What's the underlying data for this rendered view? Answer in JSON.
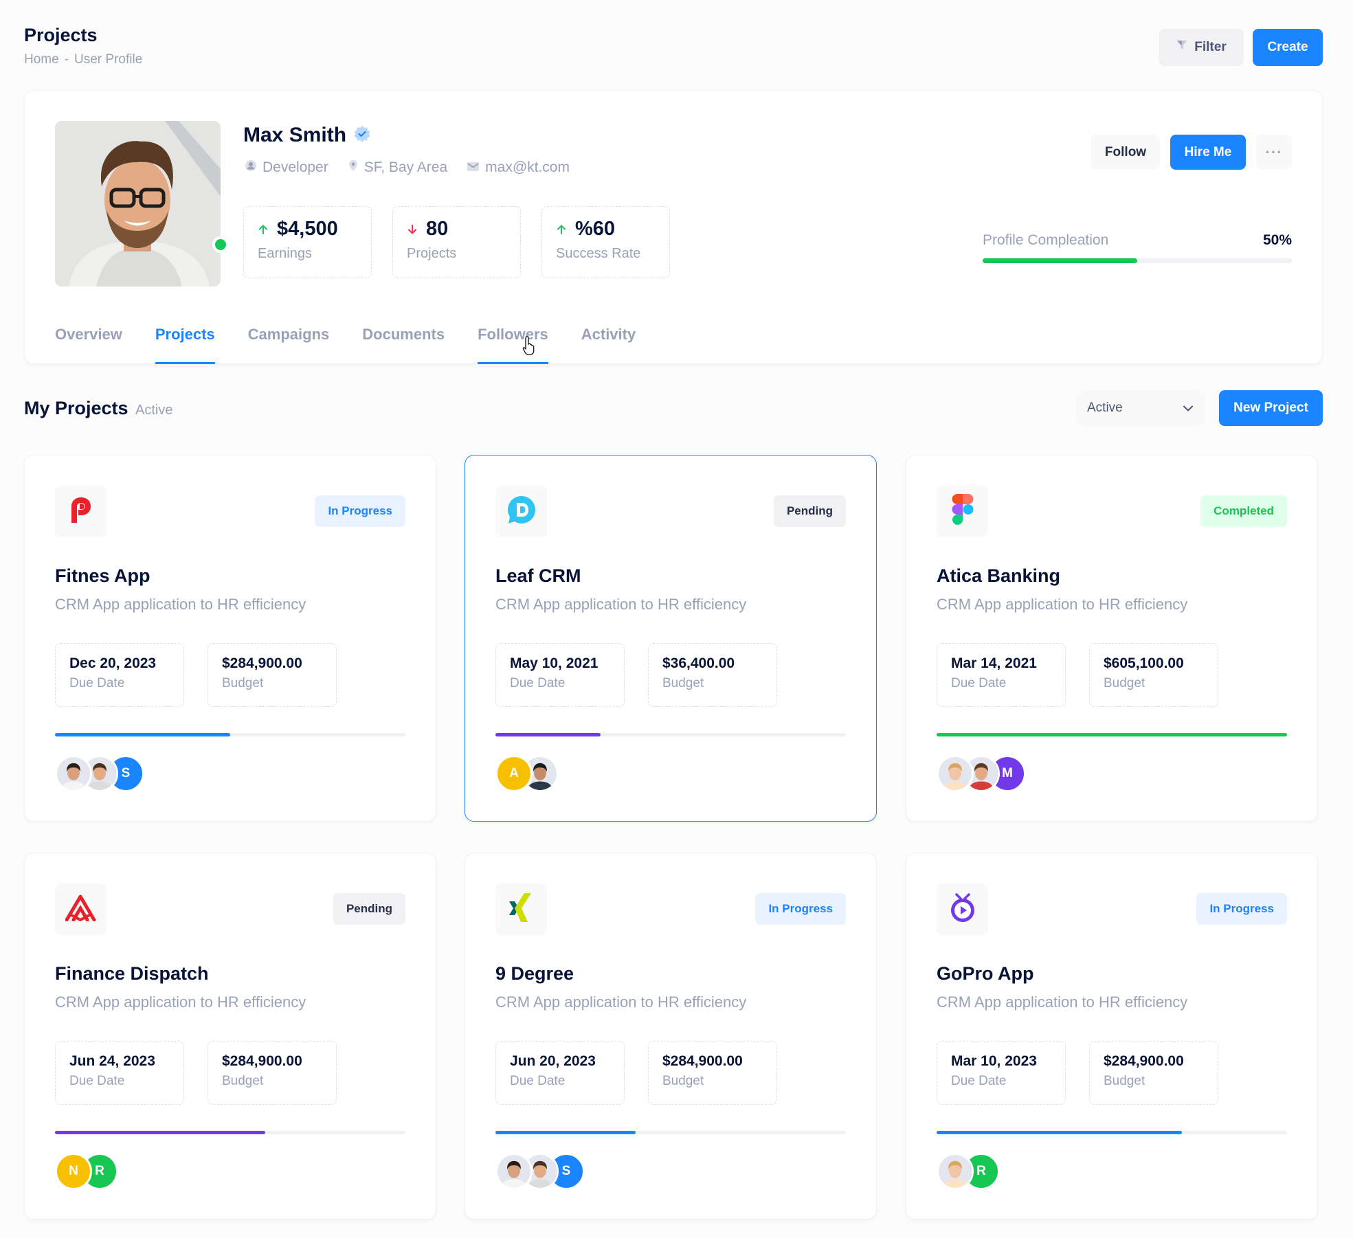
{
  "toolbar": {
    "title": "Projects",
    "breadcrumb": [
      "Home",
      "User Profile"
    ],
    "breadcrumb_sep": "-",
    "filter_label": "Filter",
    "create_label": "Create"
  },
  "profile": {
    "name": "Max Smith",
    "role": "Developer",
    "location": "SF, Bay Area",
    "email": "max@kt.com",
    "status": "online",
    "follow_label": "Follow",
    "hire_label": "Hire Me",
    "more_label": "···",
    "stats": [
      {
        "value": "$4,500",
        "label": "Earnings",
        "trend": "up"
      },
      {
        "value": "80",
        "label": "Projects",
        "trend": "down"
      },
      {
        "value": "%60",
        "label": "Success Rate",
        "trend": "up"
      }
    ],
    "completion": {
      "label": "Profile Compleation",
      "value": "50%",
      "fraction": 0.5
    },
    "tabs": [
      "Overview",
      "Projects",
      "Campaigns",
      "Documents",
      "Followers",
      "Activity"
    ],
    "active_tab": "Projects",
    "hover_tab": "Followers"
  },
  "projects_section": {
    "title": "My Projects",
    "subtitle": "Active",
    "select_value": "Active",
    "new_project_label": "New Project"
  },
  "projects": [
    {
      "name": "Fitnes App",
      "desc": "CRM App application to HR efficiency",
      "status": "In Progress",
      "due": "Dec 20, 2023",
      "due_label": "Due Date",
      "budget": "$284,900.00",
      "budget_label": "Budget",
      "progress": 0.5,
      "bar_color": "#1b84ff",
      "logo": "p-logo-icon",
      "team": [
        "photo-woman",
        "photo-man",
        "S"
      ]
    },
    {
      "name": "Leaf CRM",
      "desc": "CRM App application to HR efficiency",
      "status": "Pending",
      "due": "May 10, 2021",
      "due_label": "Due Date",
      "budget": "$36,400.00",
      "budget_label": "Budget",
      "progress": 0.3,
      "bar_color": "#7239ea",
      "logo": "chat-d-logo-icon",
      "team": [
        "A",
        "photo-man-dark"
      ]
    },
    {
      "name": "Atica Banking",
      "desc": "CRM App application to HR efficiency",
      "status": "Completed",
      "due": "Mar 14, 2021",
      "due_label": "Due Date",
      "budget": "$605,100.00",
      "budget_label": "Budget",
      "progress": 1.0,
      "bar_color": "#17c653",
      "logo": "figma-logo-icon",
      "team": [
        "photo-woman-blonde",
        "photo-man-red",
        "M"
      ]
    },
    {
      "name": "Finance Dispatch",
      "desc": "CRM App application to HR efficiency",
      "status": "Pending",
      "due": "Jun 24, 2023",
      "due_label": "Due Date",
      "budget": "$284,900.00",
      "budget_label": "Budget",
      "progress": 0.6,
      "bar_color": "#7239ea",
      "logo": "sketch-lines-logo-icon",
      "team": [
        "N",
        "R"
      ]
    },
    {
      "name": "9 Degree",
      "desc": "CRM App application to HR efficiency",
      "status": "In Progress",
      "due": "Jun 20, 2023",
      "due_label": "Due Date",
      "budget": "$284,900.00",
      "budget_label": "Budget",
      "progress": 0.4,
      "bar_color": "#1b84ff",
      "logo": "xing-logo-icon",
      "team": [
        "photo-woman",
        "photo-man",
        "S"
      ]
    },
    {
      "name": "GoPro App",
      "desc": "CRM App application to HR efficiency",
      "status": "In Progress",
      "due": "Mar 10, 2023",
      "due_label": "Due Date",
      "budget": "$284,900.00",
      "budget_label": "Budget",
      "progress": 0.7,
      "bar_color": "#1b84ff",
      "logo": "tv-play-logo-icon",
      "team": [
        "photo-woman-blonde",
        "R"
      ]
    }
  ]
}
